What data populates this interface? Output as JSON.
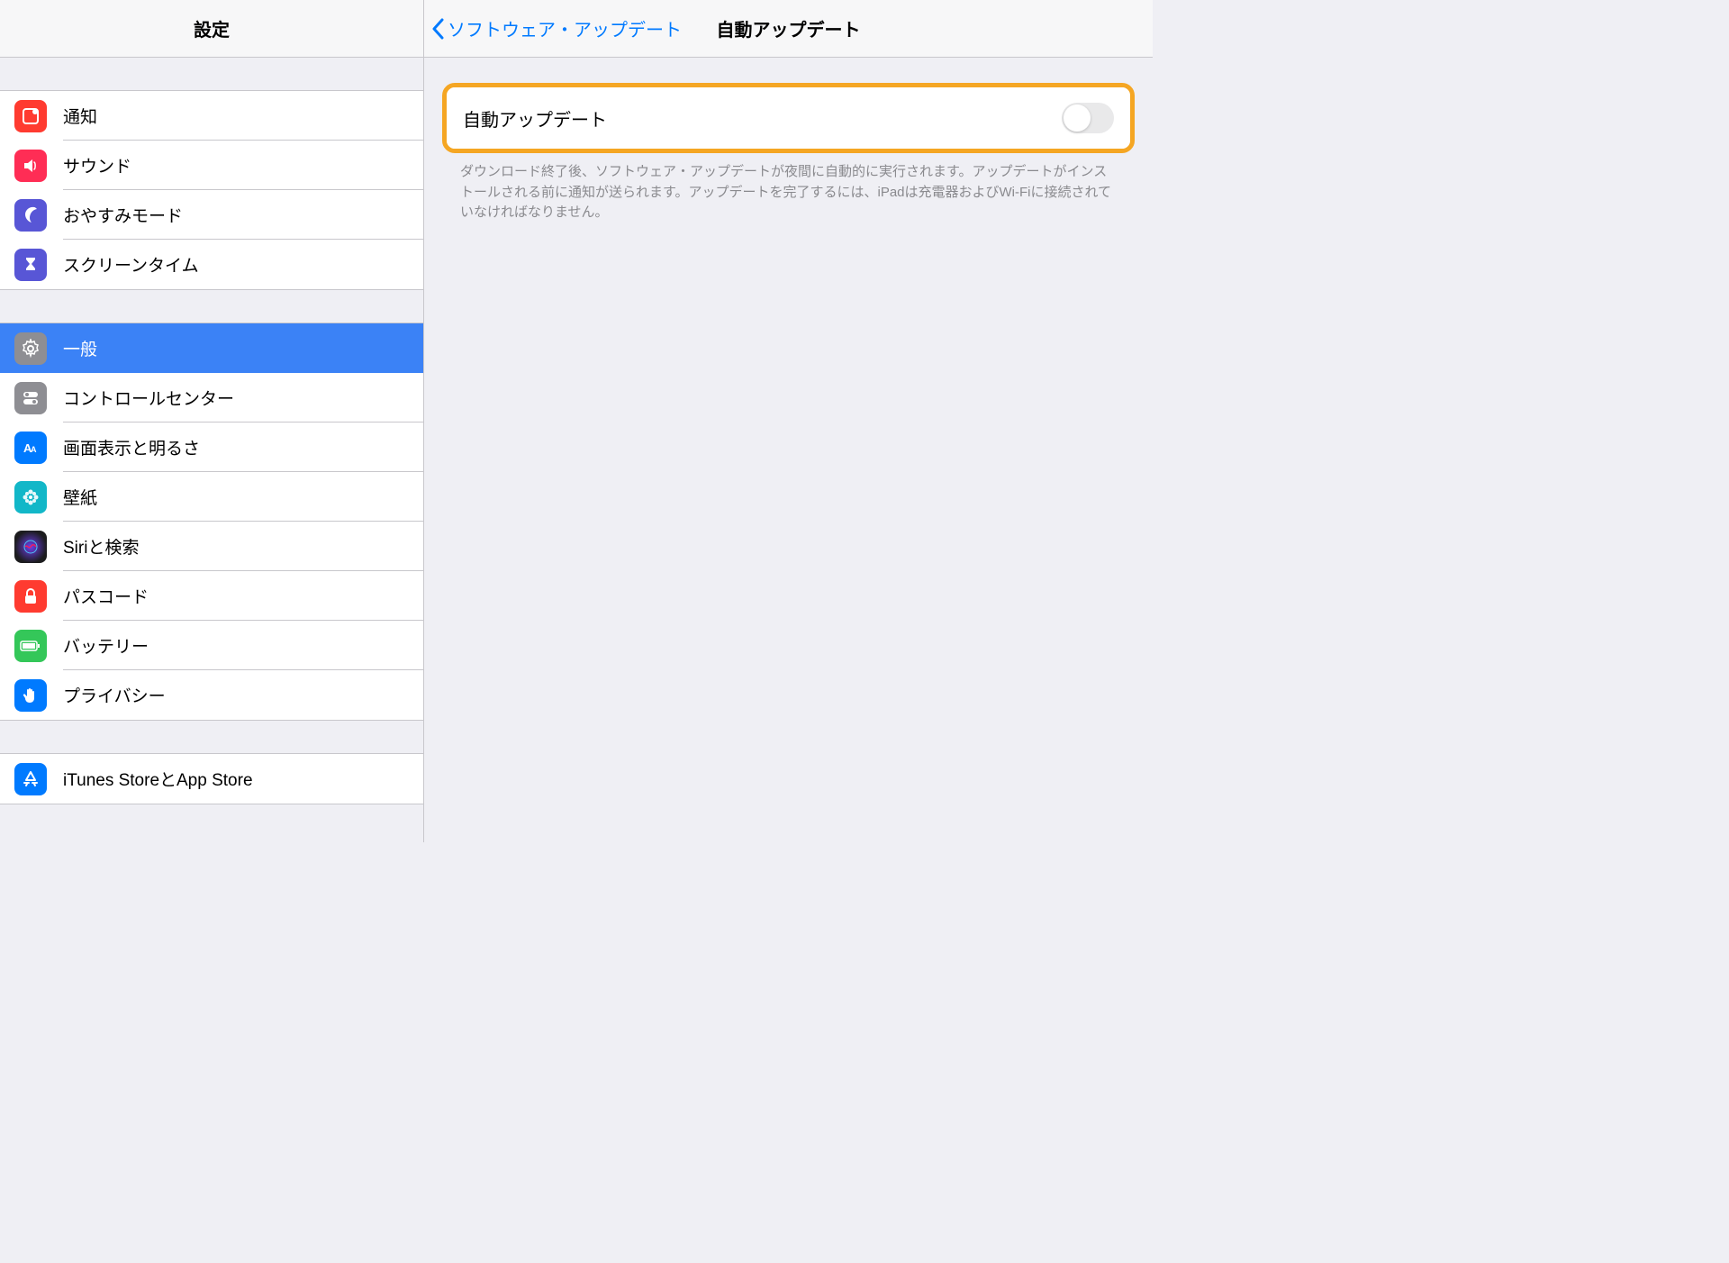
{
  "sidebar": {
    "title": "設定",
    "groups": [
      {
        "items": [
          {
            "id": "notifications",
            "label": "通知",
            "icon": "notif",
            "selected": false
          },
          {
            "id": "sounds",
            "label": "サウンド",
            "icon": "sound",
            "selected": false
          },
          {
            "id": "do-not-disturb",
            "label": "おやすみモード",
            "icon": "dnd",
            "selected": false
          },
          {
            "id": "screen-time",
            "label": "スクリーンタイム",
            "icon": "screentime",
            "selected": false
          }
        ]
      },
      {
        "items": [
          {
            "id": "general",
            "label": "一般",
            "icon": "general",
            "selected": true
          },
          {
            "id": "control-center",
            "label": "コントロールセンター",
            "icon": "control",
            "selected": false
          },
          {
            "id": "display",
            "label": "画面表示と明るさ",
            "icon": "display",
            "selected": false
          },
          {
            "id": "wallpaper",
            "label": "壁紙",
            "icon": "wallpaper",
            "selected": false
          },
          {
            "id": "siri",
            "label": "Siriと検索",
            "icon": "siri",
            "selected": false
          },
          {
            "id": "passcode",
            "label": "パスコード",
            "icon": "passcode",
            "selected": false
          },
          {
            "id": "battery",
            "label": "バッテリー",
            "icon": "battery",
            "selected": false
          },
          {
            "id": "privacy",
            "label": "プライバシー",
            "icon": "privacy",
            "selected": false
          }
        ]
      },
      {
        "items": [
          {
            "id": "itunes-appstore",
            "label": "iTunes StoreとApp Store",
            "icon": "appstore",
            "selected": false
          }
        ]
      }
    ]
  },
  "detail": {
    "back_label": "ソフトウェア・アップデート",
    "title": "自動アップデート",
    "toggle": {
      "label": "自動アップデート",
      "on": false
    },
    "footer": "ダウンロード終了後、ソフトウェア・アップデートが夜間に自動的に実行されます。アップデートがインストールされる前に通知が送られます。アップデートを完了するには、iPadは充電器およびWi-Fiに接続されていなければなりません。"
  }
}
